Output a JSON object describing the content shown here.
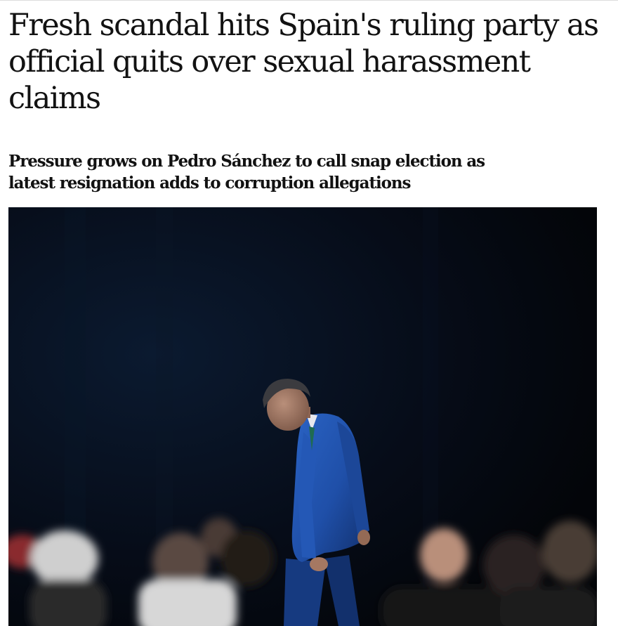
{
  "article": {
    "headline": "Fresh scandal hits Spain's ruling party as official quits over sexual harassment claims",
    "standfirst": "Pressure grows on Pedro Sánchez to call snap election as latest resignation adds to corruption allegations"
  },
  "colors": {
    "text": "#121212",
    "background": "#ffffff",
    "photo_backdrop": "#05070c",
    "suit": "#1f4fa8"
  }
}
